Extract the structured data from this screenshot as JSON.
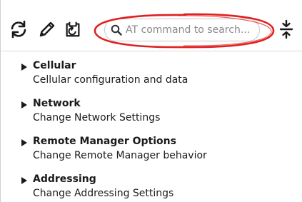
{
  "toolbar": {
    "refresh_icon": "refresh-icon",
    "edit_icon": "pencil-icon",
    "restore_icon": "restore-icon",
    "expand_collapse_icon": "expand-collapse-icon"
  },
  "search": {
    "placeholder": "AT command to search...",
    "value": "",
    "highlight_color": "#e02020"
  },
  "categories": [
    {
      "title": "Cellular",
      "description": "Cellular configuration and data"
    },
    {
      "title": "Network",
      "description": "Change Network Settings"
    },
    {
      "title": "Remote Manager Options",
      "description": "Change Remote Manager behavior"
    },
    {
      "title": "Addressing",
      "description": "Change Addressing Settings"
    }
  ]
}
